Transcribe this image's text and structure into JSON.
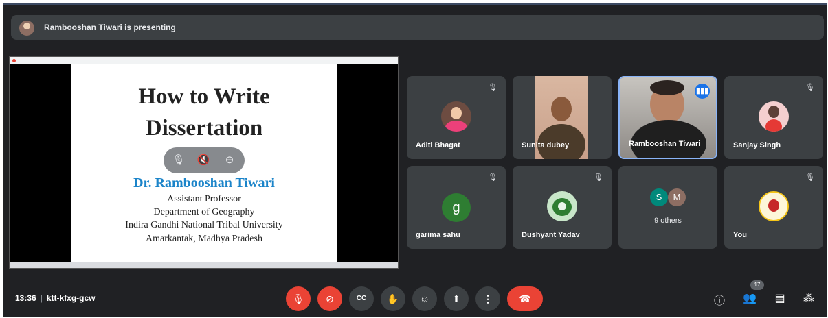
{
  "banner": {
    "text": "Rambooshan Tiwari is presenting"
  },
  "slide": {
    "title_line1": "How to Write",
    "title_line2": "Dissertation",
    "author": "Dr. Rambooshan Tiwari",
    "lines": [
      "Assistant Professor",
      "Department of Geography",
      "Indira Gandhi National Tribal University",
      "Amarkantak, Madhya Pradesh"
    ]
  },
  "participants": [
    {
      "name": "Aditi Bhagat",
      "muted": true
    },
    {
      "name": "Sunita dubey",
      "muted": false
    },
    {
      "name": "Rambooshan Tiwari",
      "speaking": true
    },
    {
      "name": "Sanjay Singh",
      "muted": true
    },
    {
      "name": "garima sahu",
      "initial": "g",
      "muted": true
    },
    {
      "name": "Dushyant Yadav",
      "muted": true
    },
    {
      "name": "You",
      "muted": true
    }
  ],
  "others": {
    "initials": [
      "S",
      "M"
    ],
    "label": "9 others"
  },
  "meeting": {
    "time": "13:36",
    "code": "ktt-kfxg-gcw"
  },
  "people_count": "17",
  "icons": {
    "mic_off": "mic-off-icon",
    "cam_off": "camera-off-icon",
    "captions": "captions-icon",
    "hand": "raise-hand-icon",
    "emoji": "emoji-icon",
    "present": "present-icon",
    "more": "more-options-icon",
    "end": "end-call-icon",
    "info": "info-icon",
    "people": "people-icon",
    "chat": "chat-icon",
    "activities": "activities-icon"
  },
  "colors": {
    "background": "#202124",
    "tile": "#3c4043",
    "red": "#ea4335",
    "speaking_blue": "#1a73e8",
    "author_blue": "#1b84c9"
  }
}
